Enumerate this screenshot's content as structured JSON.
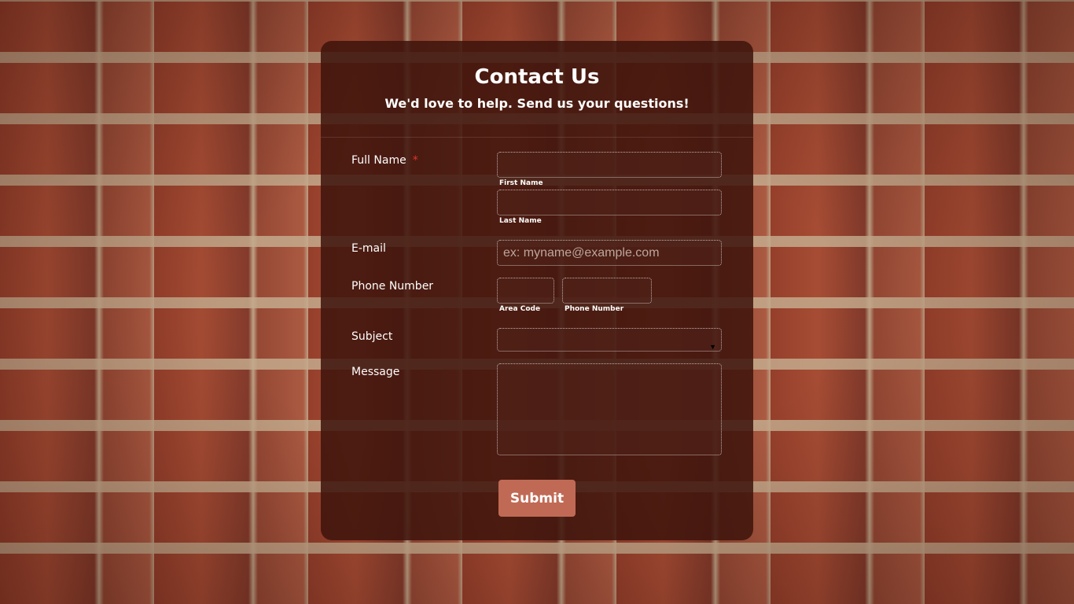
{
  "header": {
    "title": "Contact Us",
    "subtitle": "We'd love to help. Send us your questions!"
  },
  "fields": {
    "full_name": {
      "label": "Full Name",
      "required_mark": "*",
      "first_sublabel": "First Name",
      "last_sublabel": "Last Name"
    },
    "email": {
      "label": "E-mail",
      "placeholder": "ex: myname@example.com"
    },
    "phone": {
      "label": "Phone Number",
      "area_sublabel": "Area Code",
      "number_sublabel": "Phone Number"
    },
    "subject": {
      "label": "Subject",
      "selected": ""
    },
    "message": {
      "label": "Message"
    }
  },
  "submit": {
    "label": "Submit"
  },
  "colors": {
    "card_bg": "#3e140c",
    "submit_bg": "#c06a55",
    "required": "#e0352b"
  },
  "icons": {
    "dropdown": "caret-down"
  }
}
